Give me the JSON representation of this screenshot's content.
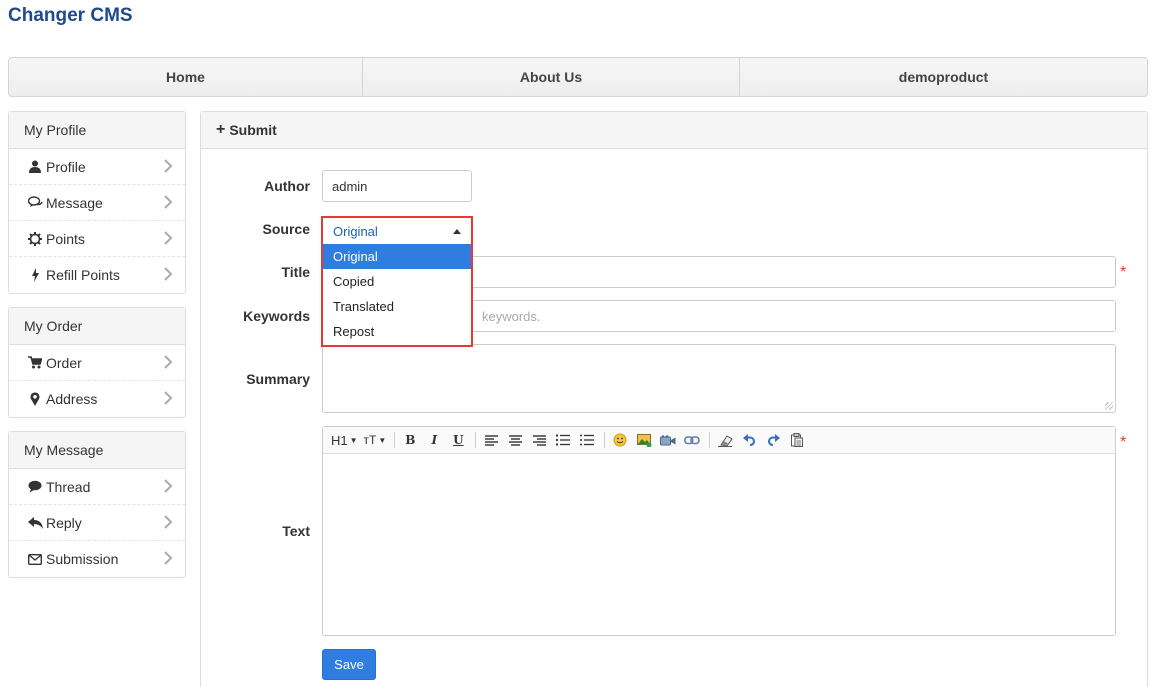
{
  "brand": "Changer CMS",
  "topnav": [
    {
      "label": "Home"
    },
    {
      "label": "About Us"
    },
    {
      "label": "demoproduct"
    }
  ],
  "sidebar": {
    "profile": {
      "title": "My Profile",
      "items": [
        {
          "label": "Profile",
          "icon": "user-icon"
        },
        {
          "label": "Message",
          "icon": "comments-icon"
        },
        {
          "label": "Points",
          "icon": "gear-icon"
        },
        {
          "label": "Refill Points",
          "icon": "bolt-icon"
        }
      ]
    },
    "order": {
      "title": "My Order",
      "items": [
        {
          "label": "Order",
          "icon": "cart-icon"
        },
        {
          "label": "Address",
          "icon": "map-marker-icon"
        }
      ]
    },
    "message": {
      "title": "My Message",
      "items": [
        {
          "label": "Thread",
          "icon": "comment-icon"
        },
        {
          "label": "Reply",
          "icon": "reply-icon"
        },
        {
          "label": "Submission",
          "icon": "envelope-icon"
        }
      ]
    }
  },
  "main": {
    "title": "Submit",
    "form": {
      "author_label": "Author",
      "author_value": "admin",
      "source_label": "Source",
      "source_selected": "Original",
      "source_options": [
        "Original",
        "Copied",
        "Translated",
        "Repost"
      ],
      "title_label": "Title",
      "keywords_label": "Keywords",
      "keywords_placeholder_visible": "keywords.",
      "summary_label": "Summary",
      "text_label": "Text",
      "required_mark": "*",
      "save_label": "Save"
    },
    "toolbar": {
      "heading": "H1",
      "fontsize": "тT",
      "bold": "B",
      "italic": "I",
      "underline": "U"
    }
  },
  "colors": {
    "brand": "#1e4a8f",
    "accent": "#2f7de0",
    "required": "#e53935",
    "highlight_border": "#e53935"
  }
}
